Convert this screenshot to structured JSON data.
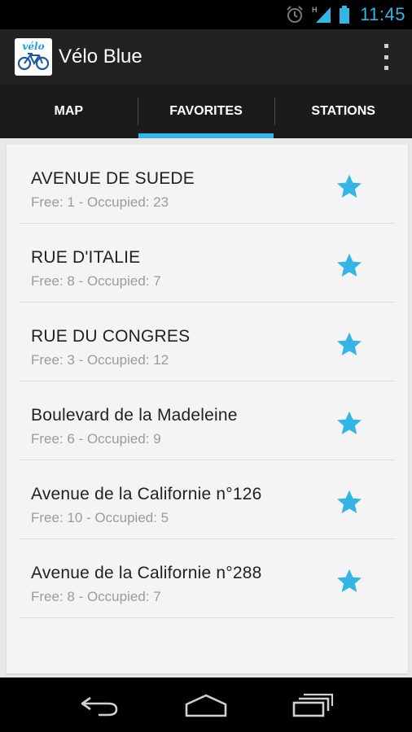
{
  "status_bar": {
    "time": "11:45",
    "network_label": "H",
    "icons": [
      "alarm-icon",
      "signal-icon",
      "battery-icon"
    ]
  },
  "action_bar": {
    "app_title": "Vélo Blue",
    "logo_text": "vélo",
    "overflow_icon": "overflow-menu-icon"
  },
  "tabs": [
    {
      "label": "MAP",
      "selected": false
    },
    {
      "label": "FAVORITES",
      "selected": true
    },
    {
      "label": "STATIONS",
      "selected": false
    }
  ],
  "favorites": [
    {
      "name": "AVENUE DE SUEDE",
      "detail": "Free: 1 - Occupied: 23",
      "favorite": true
    },
    {
      "name": "RUE D'ITALIE",
      "detail": "Free: 8 - Occupied: 7",
      "favorite": true
    },
    {
      "name": "RUE DU CONGRES",
      "detail": "Free: 3 - Occupied: 12",
      "favorite": true
    },
    {
      "name": "Boulevard de la Madeleine",
      "detail": "Free: 6 - Occupied: 9",
      "favorite": true
    },
    {
      "name": "Avenue de la Californie n°126",
      "detail": "Free: 10 - Occupied: 5",
      "favorite": true
    },
    {
      "name": "Avenue de la Californie n°288",
      "detail": "Free: 8 - Occupied: 7",
      "favorite": true
    }
  ],
  "colors": {
    "accent": "#33b5e5",
    "star": "#33b5e5",
    "action_bar": "#222222",
    "tab_bar": "#1b1b1b"
  },
  "nav_bar": {
    "icons": [
      "back-icon",
      "home-icon",
      "recent-apps-icon"
    ]
  }
}
